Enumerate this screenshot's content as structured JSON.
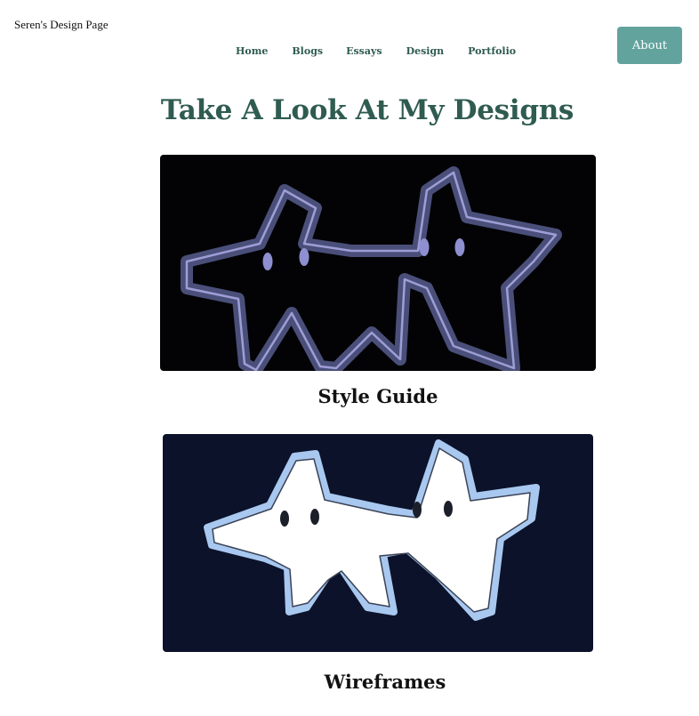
{
  "header": {
    "site_title": "Seren's Design Page",
    "nav": [
      "Home",
      "Blogs",
      "Essays",
      "Design",
      "Portfolio"
    ],
    "about_label": "About"
  },
  "main": {
    "title": "Take A Look At My Designs",
    "cards": [
      {
        "caption": "Style Guide",
        "image": "two-stars-outline-icon"
      },
      {
        "caption": "Wireframes",
        "image": "two-stars-filled-icon"
      }
    ]
  },
  "colors": {
    "accent": "#2f5b50",
    "button": "#62a39e",
    "image1_bg": "#030305",
    "image2_bg": "#0b1229"
  }
}
